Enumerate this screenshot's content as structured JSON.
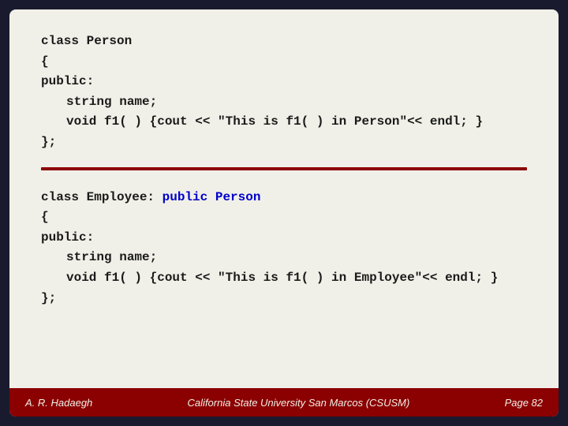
{
  "slide": {
    "code_block_1": {
      "lines": [
        {
          "text": "class Person",
          "indent": false,
          "type": "normal"
        },
        {
          "text": "{",
          "indent": false,
          "type": "normal"
        },
        {
          "text": "public:",
          "indent": false,
          "type": "normal"
        },
        {
          "text": "    string name;",
          "indent": true,
          "type": "normal"
        },
        {
          "text": "    void f1( ) {cout << \"This is f1( ) in Person\"<< endl; }",
          "indent": true,
          "type": "normal"
        },
        {
          "text": "};",
          "indent": false,
          "type": "normal"
        }
      ]
    },
    "code_block_2": {
      "prefix": "class Employee: ",
      "highlight": "public Person",
      "lines": [
        {
          "text": "{",
          "indent": false,
          "type": "normal"
        },
        {
          "text": "public:",
          "indent": false,
          "type": "normal"
        },
        {
          "text": "    string name;",
          "indent": true,
          "type": "normal"
        },
        {
          "text": "    void f1( ) {cout << \"This is f1( ) in Employee\"<< endl; }",
          "indent": true,
          "type": "normal"
        },
        {
          "text": "};",
          "indent": false,
          "type": "normal"
        }
      ]
    }
  },
  "footer": {
    "left": "A. R. Hadaegh",
    "center": "California State University San Marcos (CSUSM)",
    "right": "Page  82"
  }
}
